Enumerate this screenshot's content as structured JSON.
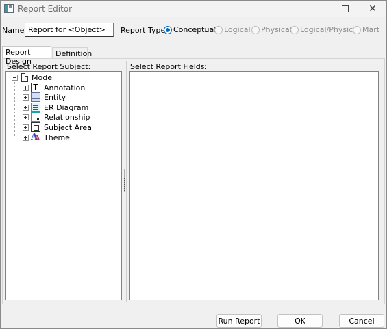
{
  "window": {
    "title": "Report Editor"
  },
  "name_field": {
    "label": "Name:",
    "value": "Report for <Object>"
  },
  "report_type": {
    "label": "Report Type:",
    "options": [
      {
        "label": "Conceptual",
        "selected": true,
        "enabled": true
      },
      {
        "label": "Logical",
        "selected": false,
        "enabled": false
      },
      {
        "label": "Physical",
        "selected": false,
        "enabled": false
      },
      {
        "label": "Logical/Physical",
        "selected": false,
        "enabled": false
      },
      {
        "label": "Mart",
        "selected": false,
        "enabled": false
      }
    ]
  },
  "tabs": [
    {
      "label": "Report Design",
      "active": true
    },
    {
      "label": "Definition",
      "active": false
    }
  ],
  "subject_panel": {
    "label": "Select Report Subject:",
    "tree": {
      "root": {
        "label": "Model",
        "icon": "document-icon",
        "expanded": true
      },
      "children": [
        {
          "label": "Annotation",
          "icon": "annotation-icon"
        },
        {
          "label": "Entity",
          "icon": "entity-icon"
        },
        {
          "label": "ER Diagram",
          "icon": "er-diagram-icon"
        },
        {
          "label": "Relationship",
          "icon": "relationship-icon"
        },
        {
          "label": "Subject Area",
          "icon": "subject-area-icon"
        },
        {
          "label": "Theme",
          "icon": "theme-icon"
        }
      ]
    }
  },
  "fields_panel": {
    "label": "Select Report Fields:"
  },
  "buttons": {
    "run_report": "Run Report",
    "ok": "OK",
    "cancel": "Cancel"
  },
  "colors": {
    "accent": "#0067c0",
    "window_bg": "#f0f0f0",
    "disabled_text": "#8c8c8c"
  }
}
